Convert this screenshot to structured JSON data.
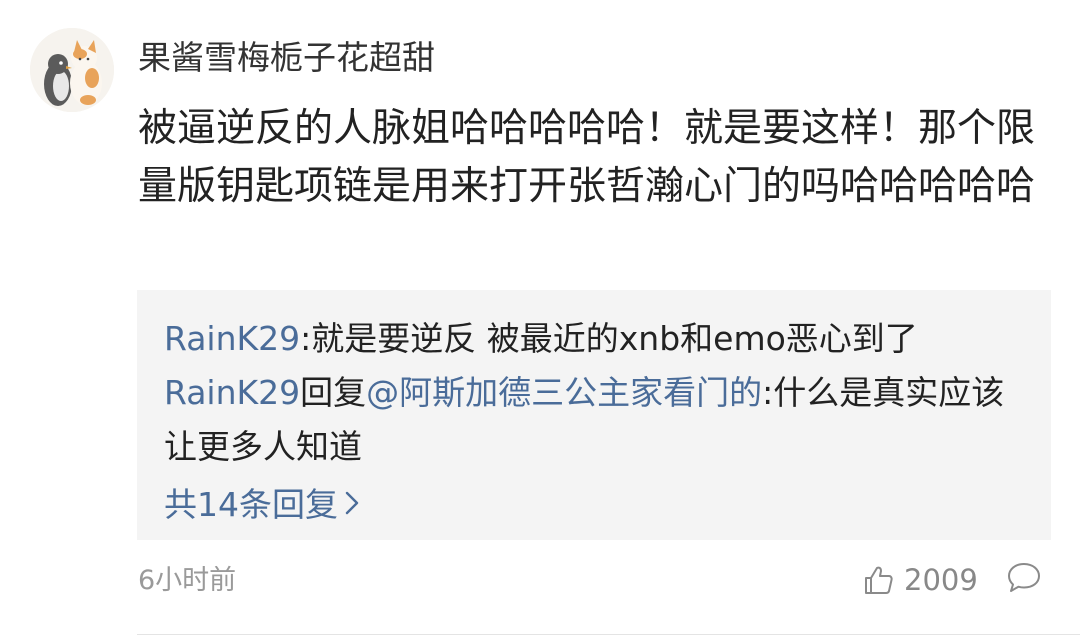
{
  "comment": {
    "username": "果酱雪梅栀子花超甜",
    "text": "被逼逆反的人脉姐哈哈哈哈哈！就是要这样！那个限量版钥匙项链是用来打开张哲瀚心门的吗哈哈哈哈哈",
    "time": "6小时前",
    "like_count": "2009"
  },
  "replies": [
    {
      "user": "RainK29",
      "sep": ":",
      "text": "就是要逆反 被最近的xnb和emo恶心到了"
    },
    {
      "user": "RainK29",
      "action": "回复",
      "target": "@阿斯加德三公主家看门的",
      "sep": ":",
      "text": "什么是真实应该让更多人知道"
    }
  ],
  "more_replies": "共14条回复",
  "icons": {
    "avatar": "cat-penguin-avatar",
    "like": "thumbs-up-icon",
    "reply": "comment-bubble-icon",
    "more": "chevron-right-icon"
  },
  "colors": {
    "link": "#4a6c99",
    "reply_bg": "#f4f4f4",
    "meta": "#9a9a9a"
  }
}
